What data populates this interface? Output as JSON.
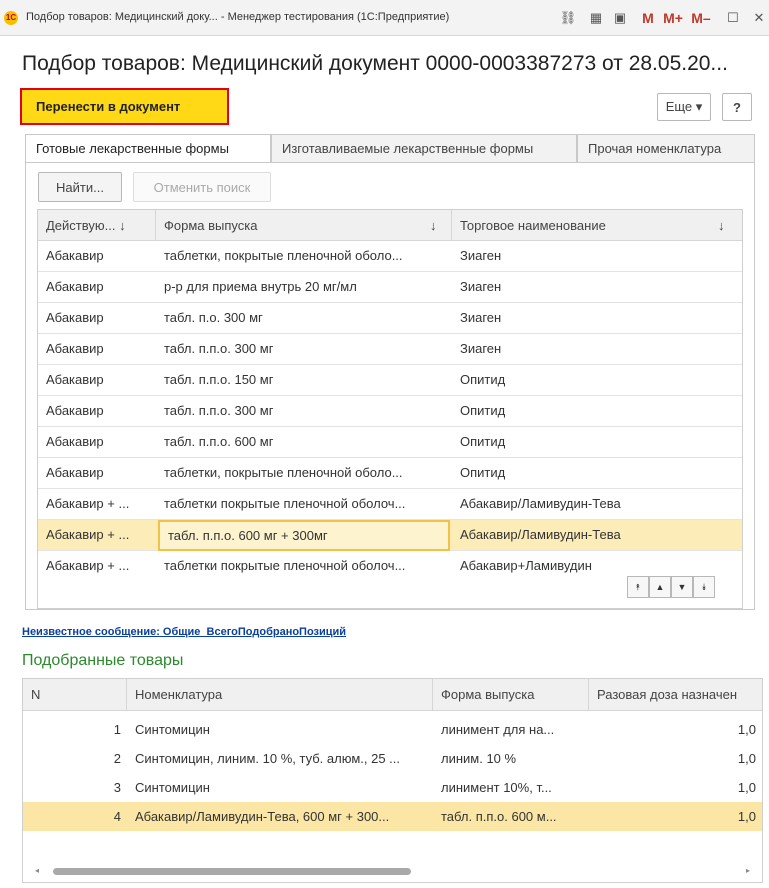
{
  "window": {
    "title": "Подбор товаров: Медицинский доку... - Менеджер тестирования (1С:Предприятие)",
    "logo_text": "1С",
    "m_buttons": [
      "M",
      "M+",
      "M–"
    ]
  },
  "page_title": "Подбор товаров: Медицинский документ 0000-0003387273 от 28.05.20...",
  "toolbar": {
    "transfer_label": "Перенести в документ",
    "more_label": "Еще ▾",
    "help_label": "?"
  },
  "tabs": [
    {
      "label": "Готовые лекарственные формы",
      "active": true
    },
    {
      "label": "Изготавливаемые лекарственные формы",
      "active": false
    },
    {
      "label": "Прочая номенклатура",
      "active": false
    }
  ],
  "search": {
    "find_label": "Найти...",
    "cancel_label": "Отменить поиск"
  },
  "products_table": {
    "columns": [
      "Действую... ↓",
      "Форма выпуска",
      "Торговое наименование"
    ],
    "sort_indicator": "↓",
    "rows": [
      [
        "Абакавир",
        "таблетки, покрытые пленочной оболо...",
        "Зиаген"
      ],
      [
        "Абакавир",
        "р-р для приема внутрь 20 мг/мл",
        "Зиаген"
      ],
      [
        "Абакавир",
        "табл. п.о. 300 мг",
        "Зиаген"
      ],
      [
        "Абакавир",
        "табл. п.п.о. 300 мг",
        "Зиаген"
      ],
      [
        "Абакавир",
        "табл. п.п.о. 150 мг",
        "Опитид"
      ],
      [
        "Абакавир",
        "табл. п.п.о. 300 мг",
        "Опитид"
      ],
      [
        "Абакавир",
        "табл. п.п.о. 600 мг",
        "Опитид"
      ],
      [
        "Абакавир",
        "таблетки, покрытые пленочной оболо...",
        "Опитид"
      ],
      [
        "Абакавир + ...",
        "таблетки покрытые пленочной оболоч...",
        "Абакавир/Ламивудин-Тева"
      ],
      [
        "Абакавир + ...",
        "табл. п.п.о. 600 мг + 300мг",
        "Абакавир/Ламивудин-Тева"
      ],
      [
        "Абакавир + ...",
        "таблетки покрытые пленочной оболоч...",
        "Абакавир+Ламивудин"
      ]
    ],
    "selected_row": 9
  },
  "message_link": "Неизвестное сообщение: Общие_ВсегоПодобраноПозиций",
  "picked": {
    "title": "Подобранные товары",
    "columns": [
      "N",
      "Номенклатура",
      "Форма выпуска",
      "Разовая доза назначен"
    ],
    "rows": [
      [
        "1",
        "Синтомицин",
        "линимент для на...",
        "1,0"
      ],
      [
        "2",
        "Синтомицин, линим. 10 %, туб. алюм., 25 ...",
        "линим. 10 %",
        "1,0"
      ],
      [
        "3",
        "Синтомицин",
        "линимент 10%, т...",
        "1,0"
      ],
      [
        "4",
        "Абакавир/Ламивудин-Тева, 600 мг + 300...",
        "табл. п.п.о. 600 м...",
        "1,0"
      ]
    ],
    "selected_row": 3
  }
}
